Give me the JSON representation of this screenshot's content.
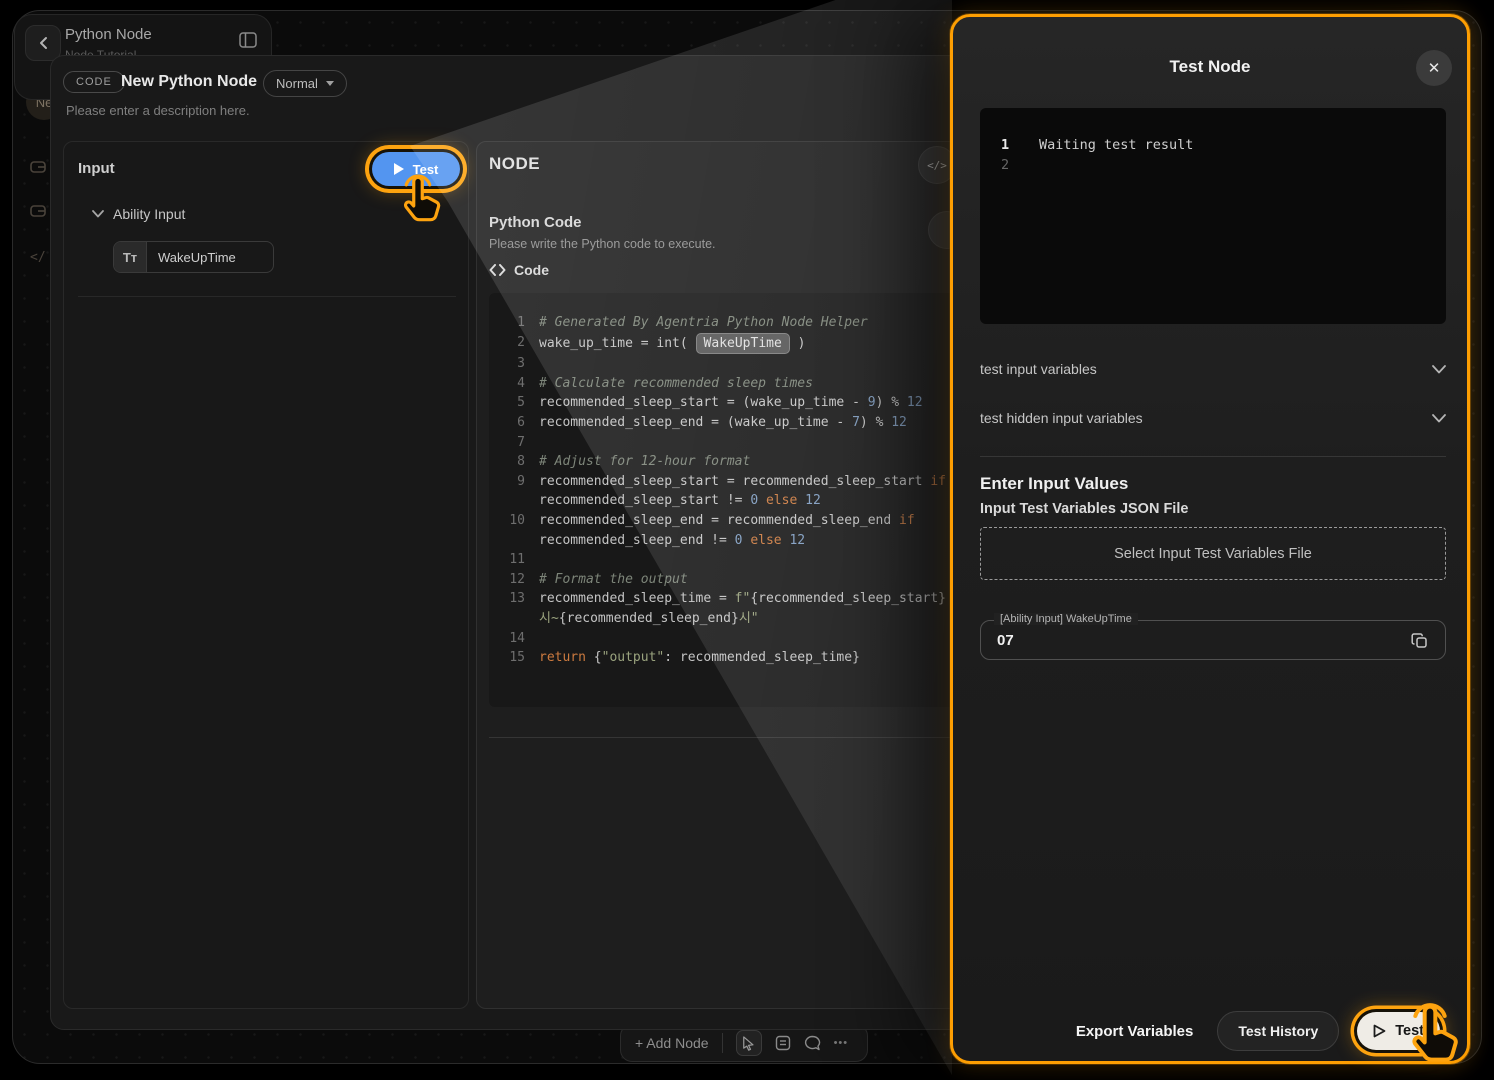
{
  "canvas": {
    "crumb_card": {
      "title": "Python Node",
      "subtitle": "Node Tutorial"
    },
    "rail_badge": "Ne",
    "rail_code_icon": "</",
    "bottom_toolbar": {
      "add_node": "+ Add Node",
      "more": "•••"
    }
  },
  "modal": {
    "badge": "CODE",
    "title": "New Python Node",
    "mode": "Normal",
    "description": "Please enter a description here.",
    "input_panel": {
      "title": "Input",
      "test_button": "Test",
      "group": "Ability Input",
      "var_type": "Tт",
      "var_name": "WakeUpTime"
    },
    "node_panel": {
      "title": "NODE",
      "code_circle_icon": "</>",
      "section": "Python Code",
      "section_desc": "Please write the Python code to execute.",
      "code_label": "Code",
      "code_rows": [
        {
          "n": "1",
          "s": [
            {
              "c": "cm",
              "t": "# Generated By Agentria Python Node Helper"
            }
          ]
        },
        {
          "n": "2",
          "s": [
            {
              "t": "wake_up_time = int( "
            },
            {
              "c": "pill",
              "t": "WakeUpTime"
            },
            {
              "t": " )"
            }
          ]
        },
        {
          "n": "3",
          "s": []
        },
        {
          "n": "4",
          "s": [
            {
              "c": "cm",
              "t": "# Calculate recommended sleep times"
            }
          ]
        },
        {
          "n": "5",
          "s": [
            {
              "t": "recommended_sleep_start = (wake_up_time "
            },
            {
              "c": "op",
              "t": "-"
            },
            {
              "t": " "
            },
            {
              "c": "num",
              "t": "9"
            },
            {
              "t": ") "
            },
            {
              "c": "op",
              "t": "%"
            },
            {
              "t": " "
            },
            {
              "c": "num",
              "t": "12"
            }
          ]
        },
        {
          "n": "6",
          "s": [
            {
              "t": "recommended_sleep_end = (wake_up_time "
            },
            {
              "c": "op",
              "t": "-"
            },
            {
              "t": " "
            },
            {
              "c": "num",
              "t": "7"
            },
            {
              "t": ") "
            },
            {
              "c": "op",
              "t": "%"
            },
            {
              "t": " "
            },
            {
              "c": "num",
              "t": "12"
            }
          ]
        },
        {
          "n": "7",
          "s": []
        },
        {
          "n": "8",
          "s": [
            {
              "c": "cm",
              "t": "# Adjust for 12-hour format"
            }
          ]
        },
        {
          "n": "9",
          "s": [
            {
              "t": "recommended_sleep_start = recommended_sleep_start "
            },
            {
              "c": "kw",
              "t": "if"
            }
          ]
        },
        {
          "n": "",
          "s": [
            {
              "t": "recommended_sleep_start != "
            },
            {
              "c": "num",
              "t": "0"
            },
            {
              "t": " "
            },
            {
              "c": "kw",
              "t": "else"
            },
            {
              "t": " "
            },
            {
              "c": "num",
              "t": "12"
            }
          ]
        },
        {
          "n": "10",
          "s": [
            {
              "t": "recommended_sleep_end = recommended_sleep_end "
            },
            {
              "c": "kw",
              "t": "if"
            }
          ]
        },
        {
          "n": "",
          "s": [
            {
              "t": "recommended_sleep_end != "
            },
            {
              "c": "num",
              "t": "0"
            },
            {
              "t": " "
            },
            {
              "c": "kw",
              "t": "else"
            },
            {
              "t": " "
            },
            {
              "c": "num",
              "t": "12"
            }
          ]
        },
        {
          "n": "11",
          "s": []
        },
        {
          "n": "12",
          "s": [
            {
              "c": "cm",
              "t": "# Format the output"
            }
          ]
        },
        {
          "n": "13",
          "s": [
            {
              "t": "recommended_sleep_time = "
            },
            {
              "c": "str",
              "t": "f\""
            },
            {
              "t": "{recommended_sleep_start}"
            }
          ]
        },
        {
          "n": "",
          "s": [
            {
              "c": "str",
              "t": "시~"
            },
            {
              "t": "{recommended_sleep_end}"
            },
            {
              "c": "str",
              "t": "시\""
            }
          ]
        },
        {
          "n": "14",
          "s": []
        },
        {
          "n": "15",
          "s": [
            {
              "c": "kw",
              "t": "return"
            },
            {
              "t": " {"
            },
            {
              "c": "str",
              "t": "\"output\""
            },
            {
              "t": ": recommended_sleep_time}"
            }
          ]
        }
      ]
    }
  },
  "test_panel": {
    "title": "Test Node",
    "close": "✕",
    "console_rows": [
      {
        "n": "1",
        "t": "Waiting test result"
      },
      {
        "n": "2",
        "t": ""
      }
    ],
    "sections": [
      {
        "label": "test input variables"
      },
      {
        "label": "test hidden input variables"
      }
    ],
    "enter_title": "Enter Input Values",
    "enter_sub": "Input Test Variables JSON File",
    "select_button": "Select Input Test Variables File",
    "field": {
      "label": "[Ability Input] WakeUpTime",
      "value": "07"
    },
    "footer": {
      "export": "Export Variables",
      "history": "Test History",
      "test": "Test"
    }
  },
  "colors": {
    "accent_orange": "#FD9E02",
    "accent_blue": "#5395F0"
  }
}
